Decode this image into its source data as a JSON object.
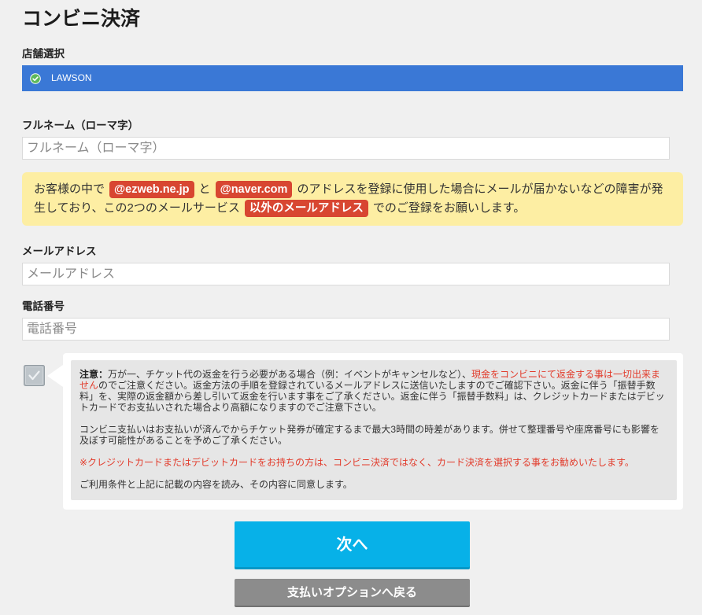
{
  "page": {
    "title": "コンビニ決済"
  },
  "store": {
    "label": "店舗選択",
    "selected": "LAWSON",
    "selected_icon": "check-circle-icon"
  },
  "fullname": {
    "label": "フルネーム（ローマ字）",
    "placeholder": "フルネーム（ローマ字）",
    "value": ""
  },
  "notice": {
    "line1": {
      "text_a": "お客様の中で",
      "badge_a": "@ezweb.ne.jp",
      "text_b": "と",
      "badge_b": "@naver.com",
      "text_c": "のアドレスを登録に使用した場合にメールが届かないなどの障害が発"
    },
    "line2": {
      "text_a": "生しており、この2つのメールサービス",
      "badge_a": "以外のメールアドレス",
      "text_b": "でのご登録をお願いします。"
    }
  },
  "email": {
    "label": "メールアドレス",
    "placeholder": "メールアドレス",
    "value": ""
  },
  "phone": {
    "label": "電話番号",
    "placeholder": "電話番号",
    "value": ""
  },
  "agreement": {
    "checked": true,
    "checkbox_icon": "checkmark-icon",
    "caution": {
      "label": "注意：",
      "line1_text": "万が一、チケット代の返金を行う必要がある場合（例：イベントがキャンセルなど）、",
      "line1_red": "現金をコンビニにて返金する事は一切出来ま",
      "line2_red": "せん",
      "line2_text": "のでご注意ください。返金方法の手順を登録されているメールアドレスに送信いたしますのでご確認下さい。返金に伴う「振替手数",
      "line3": "料」を、実際の返金額から差し引いて返金を行います事をご了承ください。返金に伴う「振替手数料」は、クレジットカードまたはデビッ",
      "line4": "トカードでお支払いされた場合より高額になりますのでご注意下さい。"
    },
    "time_lag": {
      "line1": "コンビニ支払いはお支払いが済んでからチケット発券が確定するまで最大3時間の時差があります。併せて整理番号や座席番号にも影響を",
      "line2": "及ぼす可能性があることを予めご了承ください。"
    },
    "card_recommendation": "※クレジットカードまたはデビットカードをお持ちの方は、コンビニ決済ではなく、カード決済を選択する事をお勧めいたします。",
    "consent": "ご利用条件と上記に記載の内容を読み、その内容に同意します。"
  },
  "buttons": {
    "next": "次へ",
    "back": "支払いオプションへ戻る"
  },
  "colors": {
    "page_bg": "#f0f0f0",
    "store_bar": "#3a78d6",
    "check_green": "#5cb85c",
    "notice_bg": "#fdeea3",
    "badge_bg": "#d84631",
    "caution_red": "#e23b2b",
    "next_button": "#07b1e8",
    "back_button": "#8c8c8c"
  }
}
